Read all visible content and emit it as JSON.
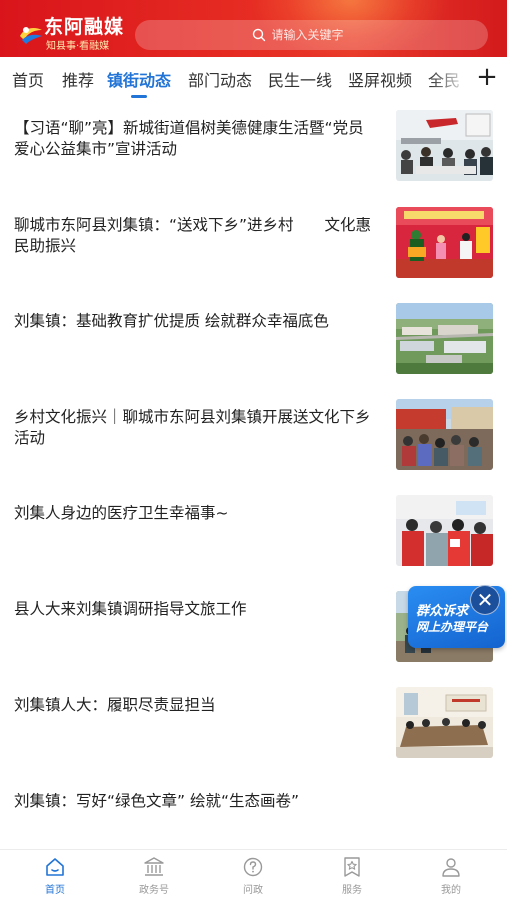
{
  "header": {
    "app_name": "东阿融媒",
    "slogan": "知县事·看融媒",
    "search_placeholder": "请输入关键字"
  },
  "tabs": [
    {
      "label": "首页"
    },
    {
      "label": "推荐"
    },
    {
      "label": "镇街动态",
      "active": true
    },
    {
      "label": "部门动态"
    },
    {
      "label": "民生一线"
    },
    {
      "label": "竖屏视频"
    },
    {
      "label": "全民"
    }
  ],
  "add_channel": "+",
  "feed": [
    {
      "title": "【习语“聊”亮】新城街道倡树美德健康生活暨“党员爱心公益集市”宣讲活动",
      "thumb": "meeting-room"
    },
    {
      "title": "聊城市东阿县刘集镇：“送戏下乡”进乡村　　文化惠民助振兴",
      "thumb": "opera-stage"
    },
    {
      "title": "刘集镇：基础教育扩优提质  绘就群众幸福底色",
      "thumb": "school-aerial"
    },
    {
      "title": "乡村文化振兴｜聊城市东阿县刘集镇开展送文化下乡活动",
      "thumb": "village-crowd"
    },
    {
      "title": "刘集人身边的医疗卫生幸福事~",
      "thumb": "medical-staff"
    },
    {
      "title": "县人大来刘集镇调研指导文旅工作",
      "thumb": "field-visit"
    },
    {
      "title": "刘集镇人大：履职尽责显担当",
      "thumb": "conference"
    },
    {
      "title": "刘集镇：写好“绿色文章” 绘就“生态画卷”",
      "thumb": ""
    }
  ],
  "floating_banner": {
    "line1": "群众诉求",
    "line2": "网上办理平台",
    "close": "✕"
  },
  "bottom_nav": [
    {
      "label": "首页",
      "icon": "home-icon",
      "active": true
    },
    {
      "label": "政务号",
      "icon": "government-icon"
    },
    {
      "label": "问政",
      "icon": "question-icon"
    },
    {
      "label": "服务",
      "icon": "service-icon"
    },
    {
      "label": "我的",
      "icon": "user-icon"
    }
  ],
  "colors": {
    "brand_red": "#d9151b",
    "accent_blue": "#2274d6"
  }
}
